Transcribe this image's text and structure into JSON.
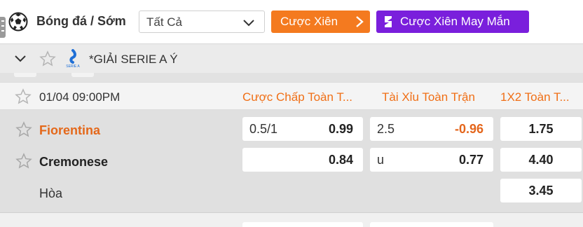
{
  "header": {
    "sport_title": "Bóng đá / Sớm",
    "filter_selected": "Tất Cả",
    "parlay_label": "Cược Xiên",
    "lucky_parlay_label": "Cược Xiên May Mắn",
    "parlay_color": "#f47a1f",
    "lucky_color": "#7a1fdc"
  },
  "league": {
    "name": "*GIẢI SERIE A Ý",
    "logo_text": "SERIE A"
  },
  "match": {
    "datetime": "01/04 09:00PM",
    "columns": [
      "Cược Chấp Toàn T...",
      "Tài Xỉu Toàn Trận",
      "1X2 Toàn T..."
    ],
    "teams": {
      "home": "Fiorentina",
      "away": "Cremonese",
      "draw": "Hòa"
    },
    "handicap": {
      "home_line": "0.5/1",
      "home_odds": "0.99",
      "away_odds": "0.84"
    },
    "over_under": {
      "line": "2.5",
      "over_odds": "-0.96",
      "under_label": "u",
      "under_odds": "0.77"
    },
    "one_x_two": {
      "home": "1.75",
      "away": "4.40",
      "draw": "3.45"
    }
  }
}
